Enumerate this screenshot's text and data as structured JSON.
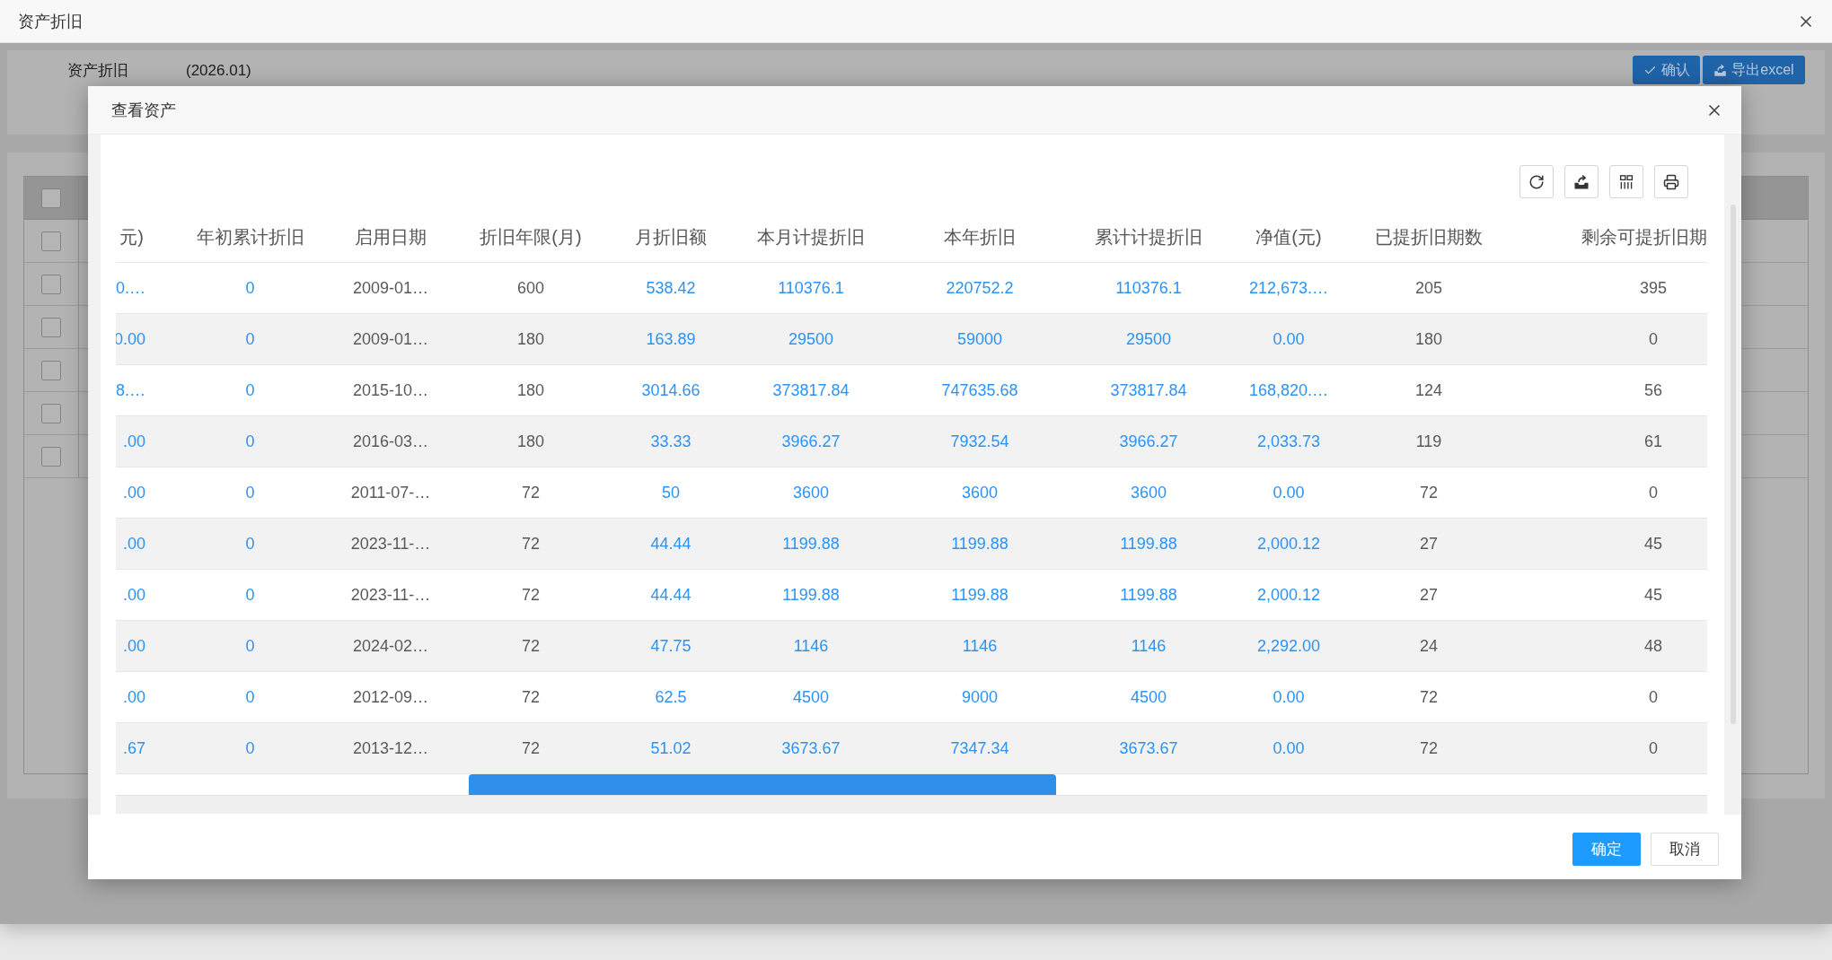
{
  "window": {
    "title": "资产折旧"
  },
  "page": {
    "title": "资产折旧",
    "period": "(2026.01)",
    "buttons": [
      {
        "label": "确认"
      },
      {
        "label": "导出excel"
      }
    ],
    "table": {
      "header_checked": false,
      "rows": [
        {
          "checked": false
        },
        {
          "checked": false
        },
        {
          "checked": false
        },
        {
          "checked": false
        },
        {
          "checked": false
        },
        {
          "checked": false
        }
      ]
    }
  },
  "dialog": {
    "title": "查看资产",
    "table": {
      "columns": [
        {
          "label": "元)",
          "kind": "amount"
        },
        {
          "label": "年初累计折旧",
          "kind": "amount"
        },
        {
          "label": "启用日期",
          "kind": "plain"
        },
        {
          "label": "折旧年限(月)",
          "kind": "plain"
        },
        {
          "label": "月折旧额",
          "kind": "amount"
        },
        {
          "label": "本月计提折旧",
          "kind": "amount"
        },
        {
          "label": "本年折旧",
          "kind": "amount"
        },
        {
          "label": "累计计提折旧",
          "kind": "amount"
        },
        {
          "label": "净值(元)",
          "kind": "amount"
        },
        {
          "label": "已提折旧期数",
          "kind": "plain"
        },
        {
          "label": "剩余可提折旧期",
          "kind": "plain"
        }
      ],
      "rows": [
        [
          "0.…",
          "0",
          "2009-01…",
          "600",
          "538.42",
          "110376.1",
          "220752.2",
          "110376.1",
          "212,673.…",
          "205",
          "395"
        ],
        [
          "0.00",
          "0",
          "2009-01…",
          "180",
          "163.89",
          "29500",
          "59000",
          "29500",
          "0.00",
          "180",
          "0"
        ],
        [
          "8.…",
          "0",
          "2015-10…",
          "180",
          "3014.66",
          "373817.84",
          "747635.68",
          "373817.84",
          "168,820.…",
          "124",
          "56"
        ],
        [
          ".00",
          "0",
          "2016-03…",
          "180",
          "33.33",
          "3966.27",
          "7932.54",
          "3966.27",
          "2,033.73",
          "119",
          "61"
        ],
        [
          ".00",
          "0",
          "2011-07-…",
          "72",
          "50",
          "3600",
          "3600",
          "3600",
          "0.00",
          "72",
          "0"
        ],
        [
          ".00",
          "0",
          "2023-11-…",
          "72",
          "44.44",
          "1199.88",
          "1199.88",
          "1199.88",
          "2,000.12",
          "27",
          "45"
        ],
        [
          ".00",
          "0",
          "2023-11-…",
          "72",
          "44.44",
          "1199.88",
          "1199.88",
          "1199.88",
          "2,000.12",
          "27",
          "45"
        ],
        [
          ".00",
          "0",
          "2024-02…",
          "72",
          "47.75",
          "1146",
          "1146",
          "1146",
          "2,292.00",
          "24",
          "48"
        ],
        [
          ".00",
          "0",
          "2012-09…",
          "72",
          "62.5",
          "4500",
          "9000",
          "4500",
          "0.00",
          "72",
          "0"
        ],
        [
          ".67",
          "0",
          "2013-12…",
          "72",
          "51.02",
          "3673.67",
          "7347.34",
          "3673.67",
          "0.00",
          "72",
          "0"
        ]
      ]
    },
    "buttons": [
      {
        "label": "确定",
        "kind": "primary"
      },
      {
        "label": "取消",
        "kind": "default"
      }
    ]
  }
}
